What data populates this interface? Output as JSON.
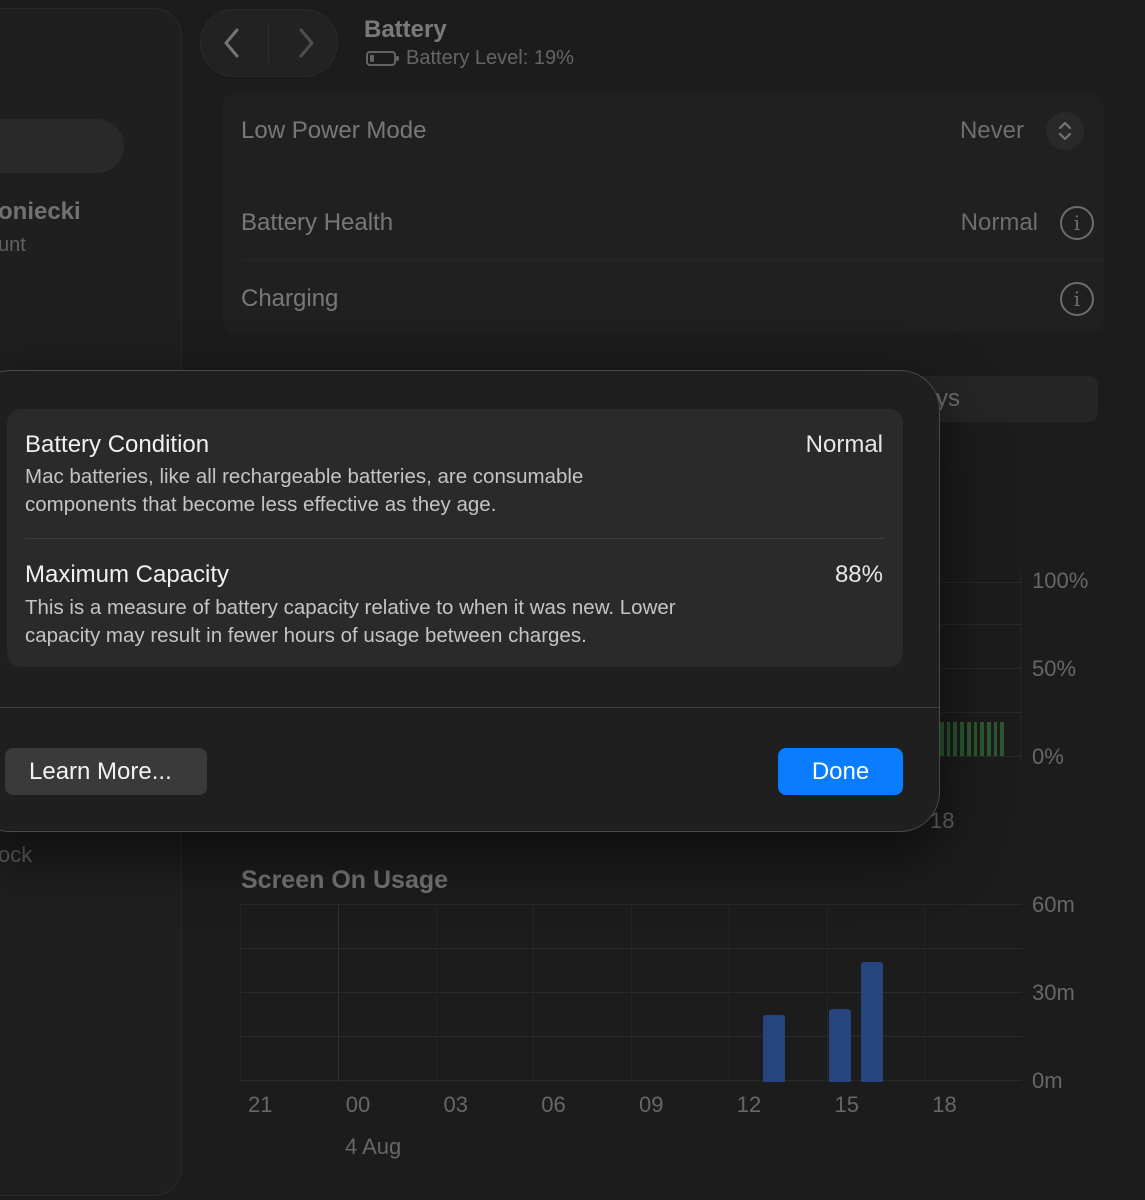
{
  "sidebar": {
    "account_name": "oniecki",
    "account_sub": "unt",
    "lock_item": "ock"
  },
  "window": {
    "title": "Battery",
    "subtitle": "Battery Level: 19%",
    "battery_level_fraction": 0.19
  },
  "settings": {
    "low_power": {
      "label": "Low Power Mode",
      "value": "Never"
    },
    "health": {
      "label": "Battery Health",
      "value": "Normal"
    },
    "charging": {
      "label": "Charging"
    }
  },
  "segmented_fragment": "ys",
  "level_chart": {
    "y_ticks": [
      "100%",
      "50%",
      "0%"
    ],
    "x_tick_visible": "18"
  },
  "chart_data": {
    "type": "bar",
    "title": "Screen On Usage",
    "x_ticks": [
      "21",
      "00",
      "03",
      "06",
      "09",
      "12",
      "15",
      "18"
    ],
    "date_label": "4 Aug",
    "y_ticks": [
      "60m",
      "30m",
      "0m"
    ],
    "ylim": [
      0,
      60
    ],
    "bars": [
      {
        "x": "13",
        "value": 23
      },
      {
        "x": "15",
        "value": 25
      },
      {
        "x": "16",
        "value": 41
      }
    ],
    "color": "#3478f6"
  },
  "dialog": {
    "condition": {
      "title": "Battery Condition",
      "value": "Normal",
      "desc_line1": "Mac batteries, like all rechargeable batteries, are consumable",
      "desc_line2": "components that become less effective as they age."
    },
    "capacity": {
      "title": "Maximum Capacity",
      "value": "88%",
      "desc_line1": "This is a measure of battery capacity relative to when it was new. Lower",
      "desc_line2": "capacity may result in fewer hours of usage between charges."
    },
    "learn_more": "Learn More...",
    "done": "Done"
  },
  "colors": {
    "accent": "#0a7cff",
    "usage_bar": "#3478f6",
    "level_bar": "#3ea24a"
  }
}
